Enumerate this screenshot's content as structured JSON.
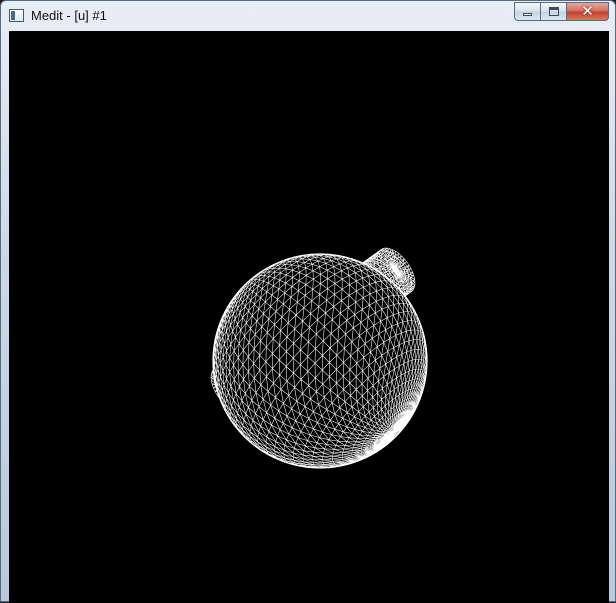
{
  "window": {
    "title": "Medit - [u] #1",
    "icons": {
      "app": "app-window-icon",
      "minimize": "minimize-icon",
      "maximize": "maximize-icon",
      "close": "close-icon"
    },
    "close_glyph": "✕"
  },
  "viewport": {
    "background": "#000000",
    "mesh_color": "#ffffff",
    "render_mode": "wireframe",
    "objects": [
      "sphere",
      "cylinder"
    ]
  }
}
